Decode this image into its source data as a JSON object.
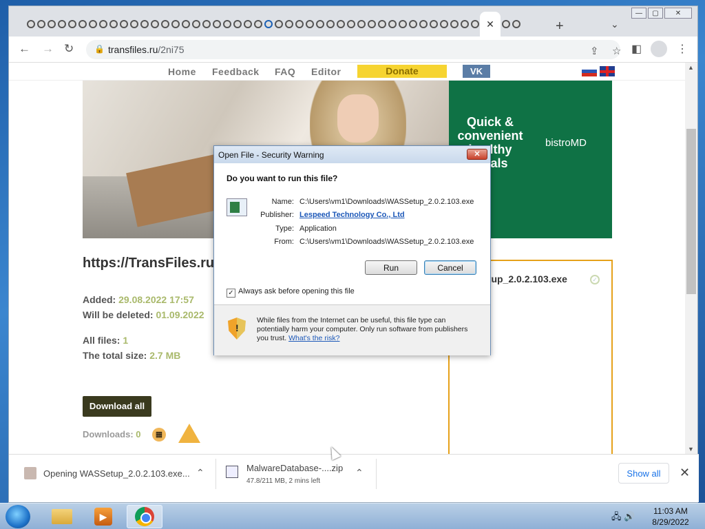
{
  "browser": {
    "url_host": "transfiles.ru",
    "url_path": "/2ni75",
    "active_tab_close": "✕",
    "new_tab": "+",
    "tab_menu": "⌄"
  },
  "site_nav": {
    "home": "Home",
    "feedback": "Feedback",
    "faq": "FAQ",
    "editor": "Editor",
    "donate": "Donate",
    "vk": "VK"
  },
  "ad": {
    "headline": "Quick & convenient healthy meals",
    "brand": "bistroMD"
  },
  "page": {
    "title": "https://TransFiles.ru",
    "added_label": "Added:",
    "added_value": "29.08.2022 17:57",
    "deleted_label": "Will be deleted:",
    "deleted_value": "01.09.2022",
    "all_files_label": "All files:",
    "all_files_value": "1",
    "total_size_label": "The total size:",
    "total_size_value": "2.7 MB",
    "download_all": "Download all",
    "downloads_label": "Downloads:",
    "downloads_value": "0",
    "file_name": "etup_2.0.2.103.exe"
  },
  "dialog": {
    "title": "Open File - Security Warning",
    "question": "Do you want to run this file?",
    "name_label": "Name:",
    "name_value": "C:\\Users\\vm1\\Downloads\\WASSetup_2.0.2.103.exe",
    "publisher_label": "Publisher:",
    "publisher_value": "Lespeed Technology Co., Ltd",
    "type_label": "Type:",
    "type_value": "Application",
    "from_label": "From:",
    "from_value": "C:\\Users\\vm1\\Downloads\\WASSetup_2.0.2.103.exe",
    "run": "Run",
    "cancel": "Cancel",
    "checkbox_label": "Always ask before opening this file",
    "warning_text": "While files from the Internet can be useful, this file type can potentially harm your computer. Only run software from publishers you trust.",
    "risk_link": "What's the risk?"
  },
  "downloads_bar": {
    "item1_name": "Opening WASSetup_2.0.2.103.exe...",
    "item2_name": "MalwareDatabase-....zip",
    "item2_status": "47.8/211 MB, 2 mins left",
    "show_all": "Show all"
  },
  "taskbar": {
    "time": "11:03 AM",
    "date": "8/29/2022"
  }
}
